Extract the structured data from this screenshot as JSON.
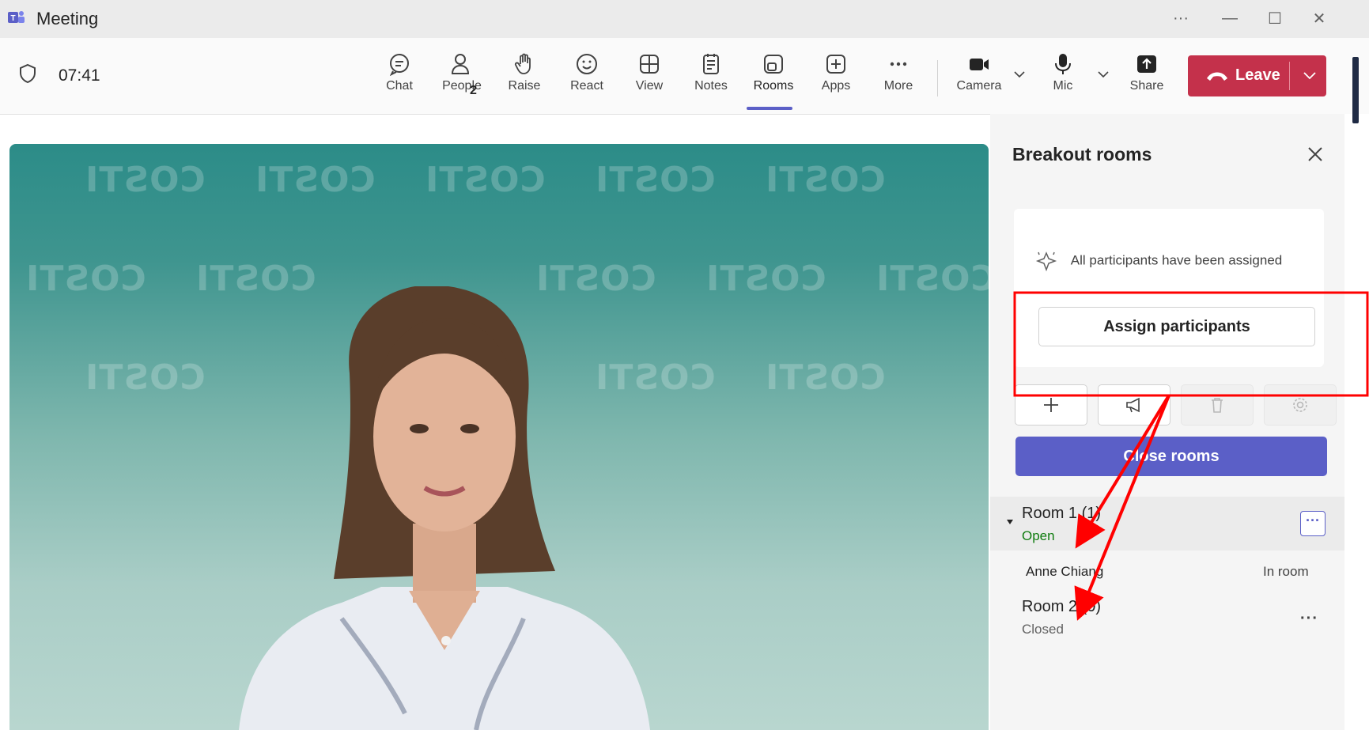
{
  "window": {
    "title": "Meeting",
    "app_icon": "teams-icon",
    "controls": {
      "more": "···",
      "minimize": "—",
      "maximize": "☐",
      "close": "✕"
    }
  },
  "toolbar": {
    "timer": "07:41",
    "people_count": "2",
    "buttons": [
      {
        "label": "Chat",
        "icon": "chat-icon"
      },
      {
        "label": "People",
        "icon": "people-icon"
      },
      {
        "label": "Raise",
        "icon": "raise-hand-icon"
      },
      {
        "label": "React",
        "icon": "smiley-icon"
      },
      {
        "label": "View",
        "icon": "grid-icon"
      },
      {
        "label": "Notes",
        "icon": "notes-icon"
      },
      {
        "label": "Rooms",
        "icon": "rooms-icon",
        "active": true
      },
      {
        "label": "Apps",
        "icon": "add-app-icon"
      },
      {
        "label": "More",
        "icon": "ellipsis-icon"
      }
    ],
    "media": [
      {
        "label": "Camera",
        "icon": "camera-icon"
      },
      {
        "label": "Mic",
        "icon": "mic-icon"
      },
      {
        "label": "Share",
        "icon": "share-icon"
      }
    ],
    "leave_label": "Leave",
    "accent_color": "#5b5fc7",
    "leave_color": "#c4314b"
  },
  "video": {
    "watermark_text": "COSTI",
    "background_colors": [
      "#2c8c88",
      "#b8d6cf"
    ]
  },
  "breakout_panel": {
    "title": "Breakout rooms",
    "assigned_message": "All participants have been assigned",
    "assign_button": "Assign participants",
    "close_rooms_button": "Close rooms",
    "rooms": [
      {
        "name": "Room 1 (1)",
        "status": "Open",
        "status_color": "#107c10",
        "participants": [
          {
            "name": "Anne Chiang",
            "status": "In room"
          }
        ]
      },
      {
        "name": "Room 2 (0)",
        "status": "Closed",
        "status_color": "#616161",
        "participants": []
      }
    ]
  }
}
